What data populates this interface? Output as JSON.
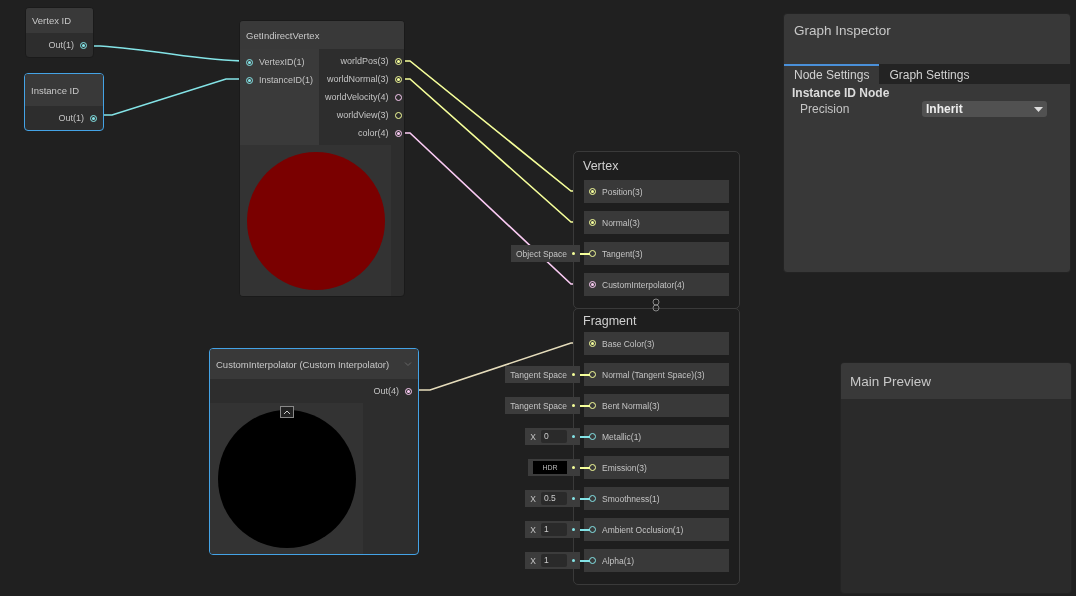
{
  "nodes": [
    {
      "title": "Vertex ID",
      "selected": false,
      "outputs": [
        {
          "label": "Out(1)",
          "kind": "float",
          "connected": true
        }
      ]
    },
    {
      "title": "Instance ID",
      "selected": true,
      "outputs": [
        {
          "label": "Out(1)",
          "kind": "float",
          "connected": true
        }
      ]
    },
    {
      "title": "GetIndirectVertex",
      "selected": false,
      "inputs": [
        {
          "label": "VertexID(1)",
          "kind": "float",
          "connected": true
        },
        {
          "label": "InstanceID(1)",
          "kind": "float",
          "connected": true
        }
      ],
      "outputs": [
        {
          "label": "worldPos(3)",
          "kind": "vector3",
          "connected": true
        },
        {
          "label": "worldNormal(3)",
          "kind": "vector3",
          "connected": true
        },
        {
          "label": "worldVelocity(4)",
          "kind": "vector4",
          "connected": false
        },
        {
          "label": "worldView(3)",
          "kind": "vector3",
          "connected": false
        },
        {
          "label": "color(4)",
          "kind": "vector4",
          "connected": true
        }
      ]
    },
    {
      "title": "CustomInterpolator (Custom Interpolator)",
      "selected": true,
      "outputs": [
        {
          "label": "Out(4)",
          "kind": "vector4",
          "connected": true
        }
      ]
    }
  ],
  "contexts": [
    {
      "title": "Vertex",
      "blocks": [
        {
          "label": "Position(3)",
          "kind": "vector3",
          "connected": true
        },
        {
          "label": "Normal(3)",
          "kind": "vector3",
          "connected": true
        },
        {
          "label": "Tangent(3)",
          "kind": "vector3",
          "connected": false,
          "default": {
            "kind": "space",
            "text": "Object Space"
          }
        },
        {
          "label": "CustomInterpolator(4)",
          "kind": "vector4",
          "connected": true
        }
      ]
    },
    {
      "title": "Fragment",
      "blocks": [
        {
          "label": "Base Color(3)",
          "kind": "vector3",
          "connected": true
        },
        {
          "label": "Normal (Tangent Space)(3)",
          "kind": "vector3",
          "connected": false,
          "default": {
            "kind": "space",
            "text": "Tangent Space"
          }
        },
        {
          "label": "Bent Normal(3)",
          "kind": "vector3",
          "connected": false,
          "default": {
            "kind": "space",
            "text": "Tangent Space"
          }
        },
        {
          "label": "Metallic(1)",
          "kind": "float",
          "connected": false,
          "default": {
            "kind": "float",
            "axis": "X",
            "value": "0"
          }
        },
        {
          "label": "Emission(3)",
          "kind": "vector3",
          "connected": false,
          "default": {
            "kind": "color",
            "text": "HDR"
          }
        },
        {
          "label": "Smoothness(1)",
          "kind": "float",
          "connected": false,
          "default": {
            "kind": "float",
            "axis": "X",
            "value": "0.5"
          }
        },
        {
          "label": "Ambient Occlusion(1)",
          "kind": "float",
          "connected": false,
          "default": {
            "kind": "float",
            "axis": "X",
            "value": "1"
          }
        },
        {
          "label": "Alpha(1)",
          "kind": "float",
          "connected": false,
          "default": {
            "kind": "float",
            "axis": "X",
            "value": "1"
          }
        }
      ]
    }
  ],
  "inspector": {
    "title": "Graph Inspector",
    "tabs": [
      {
        "label": "Node Settings",
        "selected": true
      },
      {
        "label": "Graph Settings",
        "selected": false
      }
    ],
    "section": "Instance ID Node",
    "fields": [
      {
        "label": "Precision",
        "value": "Inherit"
      }
    ]
  },
  "main_preview": {
    "title": "Main Preview"
  }
}
